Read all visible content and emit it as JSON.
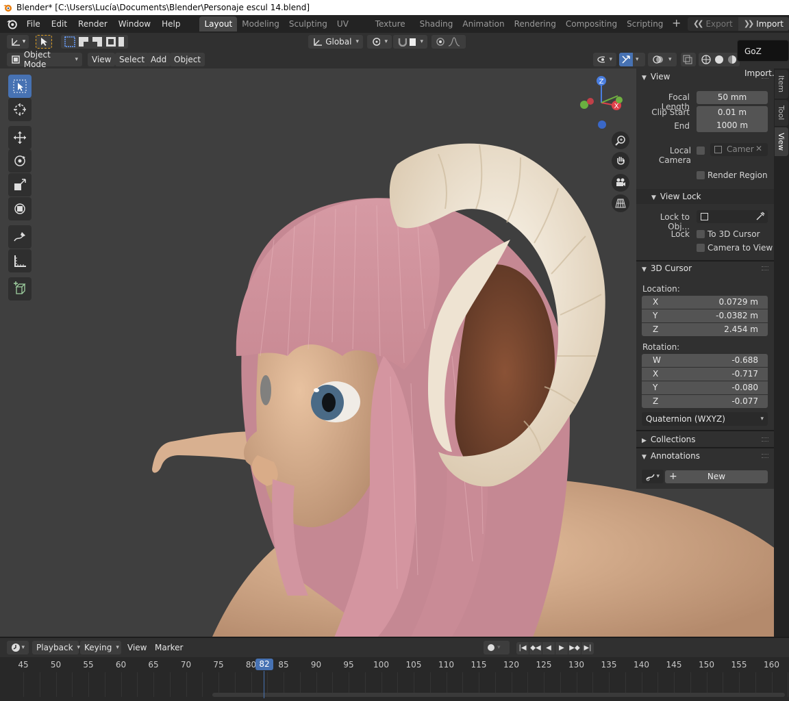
{
  "os_title": "Blender* [C:\\Users\\Lucía\\Documents\\Blender\\Personaje escul 14.blend]",
  "menu": [
    "File",
    "Edit",
    "Render",
    "Window",
    "Help"
  ],
  "workspace_tabs": [
    "Layout",
    "Modeling",
    "Sculpting",
    "UV Editing",
    "Texture Paint",
    "Shading",
    "Animation",
    "Rendering",
    "Compositing",
    "Scripting"
  ],
  "active_tab": "Layout",
  "export_label": "Export",
  "import_label": "Import",
  "tooltip": "GoZ Import.",
  "tool_header": {
    "transform_orientation": "Global"
  },
  "viewport_header": {
    "mode": "Object Mode",
    "menus": [
      "View",
      "Select",
      "Add",
      "Object"
    ]
  },
  "sidebar_tabs": [
    "Item",
    "Tool",
    "View"
  ],
  "active_sidebar_tab": "View",
  "view_panel": {
    "title": "View",
    "focal_length_label": "Focal Length",
    "focal_length": "50 mm",
    "clip_start_label": "Clip Start",
    "clip_start": "0.01 m",
    "end_label": "End",
    "end": "1000 m",
    "local_camera_label": "Local Camera",
    "camera_placeholder": "Camer",
    "render_region": "Render Region",
    "view_lock_title": "View Lock",
    "lock_to_obj_label": "Lock to Obj...",
    "lock_label": "Lock",
    "to_3d_cursor": "To 3D Cursor",
    "camera_to_view": "Camera to View"
  },
  "cursor_panel": {
    "title": "3D Cursor",
    "location_label": "Location:",
    "location": [
      {
        "axis": "X",
        "value": "0.0729 m"
      },
      {
        "axis": "Y",
        "value": "-0.0382 m"
      },
      {
        "axis": "Z",
        "value": "2.454 m"
      }
    ],
    "rotation_label": "Rotation:",
    "rotation": [
      {
        "axis": "W",
        "value": "-0.688"
      },
      {
        "axis": "X",
        "value": "-0.717"
      },
      {
        "axis": "Y",
        "value": "-0.080"
      },
      {
        "axis": "Z",
        "value": "-0.077"
      }
    ],
    "rotation_mode": "Quaternion (WXYZ)"
  },
  "collections_title": "Collections",
  "annotations_title": "Annotations",
  "annotations_new": "New",
  "timeline": {
    "menus": [
      "Playback",
      "Keying",
      "View",
      "Marker"
    ],
    "current_frame": "82",
    "frame_labels": [
      "45",
      "50",
      "55",
      "60",
      "65",
      "70",
      "75",
      "80",
      "85",
      "90",
      "95",
      "100",
      "105",
      "110",
      "115",
      "120",
      "125",
      "130",
      "135",
      "140",
      "145",
      "150",
      "155",
      "160"
    ]
  },
  "colors": {
    "accent": "#4772b3",
    "hair": "#d9a0a8",
    "skin": "#e2b996",
    "horn": "#f2e8d8",
    "ear_inner": "#7a4a32",
    "viewport_bg": "#3f3f3f"
  }
}
